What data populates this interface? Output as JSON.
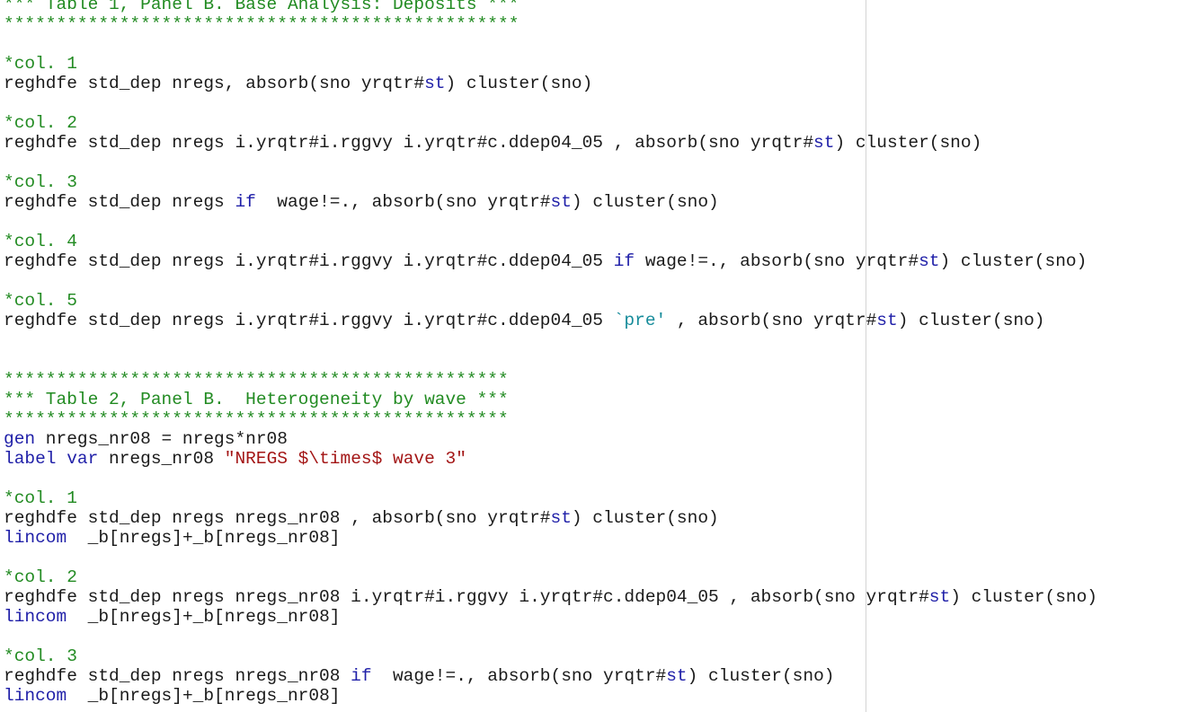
{
  "colors": {
    "background": "#ffffff",
    "plain": "#1a1a1a",
    "comment": "#228b22",
    "keyword": "#1f1fa8",
    "string": "#a31515",
    "local_macro": "#178c9b",
    "edge_rule": "#d4d4d4"
  },
  "editor": {
    "lines": [
      [
        {
          "t": "comment",
          "s": "*** Table 1, Panel B. Base Analysis: Deposits ***"
        }
      ],
      [
        {
          "t": "comment",
          "s": "*************************************************"
        }
      ],
      [],
      [
        {
          "t": "comment",
          "s": "*col. 1"
        }
      ],
      [
        {
          "t": "plain",
          "s": "reghdfe std_dep nregs, absorb(sno yrqtr#"
        },
        {
          "t": "keyword",
          "s": "st"
        },
        {
          "t": "plain",
          "s": ") cluster(sno)"
        }
      ],
      [],
      [
        {
          "t": "comment",
          "s": "*col. 2"
        }
      ],
      [
        {
          "t": "plain",
          "s": "reghdfe std_dep nregs i.yrqtr#i.rggvy i.yrqtr#c.ddep04_05 , absorb(sno yrqtr#"
        },
        {
          "t": "keyword",
          "s": "st"
        },
        {
          "t": "plain",
          "s": ") cluster(sno)"
        }
      ],
      [],
      [
        {
          "t": "comment",
          "s": "*col. 3"
        }
      ],
      [
        {
          "t": "plain",
          "s": "reghdfe std_dep nregs "
        },
        {
          "t": "keyword",
          "s": "if"
        },
        {
          "t": "plain",
          "s": "  wage!=., absorb(sno yrqtr#"
        },
        {
          "t": "keyword",
          "s": "st"
        },
        {
          "t": "plain",
          "s": ") cluster(sno)"
        }
      ],
      [],
      [
        {
          "t": "comment",
          "s": "*col. 4"
        }
      ],
      [
        {
          "t": "plain",
          "s": "reghdfe std_dep nregs i.yrqtr#i.rggvy i.yrqtr#c.ddep04_05 "
        },
        {
          "t": "keyword",
          "s": "if"
        },
        {
          "t": "plain",
          "s": " wage!=., absorb(sno yrqtr#"
        },
        {
          "t": "keyword",
          "s": "st"
        },
        {
          "t": "plain",
          "s": ") cluster(sno)"
        }
      ],
      [],
      [
        {
          "t": "comment",
          "s": "*col. 5"
        }
      ],
      [
        {
          "t": "plain",
          "s": "reghdfe std_dep nregs i.yrqtr#i.rggvy i.yrqtr#c.ddep04_05 "
        },
        {
          "t": "local",
          "s": "`pre'"
        },
        {
          "t": "plain",
          "s": " , absorb(sno yrqtr#"
        },
        {
          "t": "keyword",
          "s": "st"
        },
        {
          "t": "plain",
          "s": ") cluster(sno)"
        }
      ],
      [],
      [],
      [
        {
          "t": "comment",
          "s": "************************************************"
        }
      ],
      [
        {
          "t": "comment",
          "s": "*** Table 2, Panel B.  Heterogeneity by wave ***"
        }
      ],
      [
        {
          "t": "comment",
          "s": "************************************************"
        }
      ],
      [
        {
          "t": "keyword",
          "s": "gen"
        },
        {
          "t": "plain",
          "s": " nregs_nr08 = nregs*nr08"
        }
      ],
      [
        {
          "t": "keyword",
          "s": "label var"
        },
        {
          "t": "plain",
          "s": " nregs_nr08 "
        },
        {
          "t": "string",
          "s": "\"NREGS $\\times$ wave 3\""
        }
      ],
      [],
      [
        {
          "t": "comment",
          "s": "*col. 1"
        }
      ],
      [
        {
          "t": "plain",
          "s": "reghdfe std_dep nregs nregs_nr08 , absorb(sno yrqtr#"
        },
        {
          "t": "keyword",
          "s": "st"
        },
        {
          "t": "plain",
          "s": ") cluster(sno)"
        }
      ],
      [
        {
          "t": "keyword",
          "s": "lincom"
        },
        {
          "t": "plain",
          "s": "  _b[nregs]+_b[nregs_nr08]"
        }
      ],
      [],
      [
        {
          "t": "comment",
          "s": "*col. 2"
        }
      ],
      [
        {
          "t": "plain",
          "s": "reghdfe std_dep nregs nregs_nr08 i.yrqtr#i.rggvy i.yrqtr#c.ddep04_05 , absorb(sno yrqtr#"
        },
        {
          "t": "keyword",
          "s": "st"
        },
        {
          "t": "plain",
          "s": ") cluster(sno)"
        }
      ],
      [
        {
          "t": "keyword",
          "s": "lincom"
        },
        {
          "t": "plain",
          "s": "  _b[nregs]+_b[nregs_nr08]"
        }
      ],
      [],
      [
        {
          "t": "comment",
          "s": "*col. 3"
        }
      ],
      [
        {
          "t": "plain",
          "s": "reghdfe std_dep nregs nregs_nr08 "
        },
        {
          "t": "keyword",
          "s": "if"
        },
        {
          "t": "plain",
          "s": "  wage!=., absorb(sno yrqtr#"
        },
        {
          "t": "keyword",
          "s": "st"
        },
        {
          "t": "plain",
          "s": ") cluster(sno)"
        }
      ],
      [
        {
          "t": "keyword",
          "s": "lincom"
        },
        {
          "t": "plain",
          "s": "  _b[nregs]+_b[nregs_nr08]"
        }
      ]
    ]
  }
}
